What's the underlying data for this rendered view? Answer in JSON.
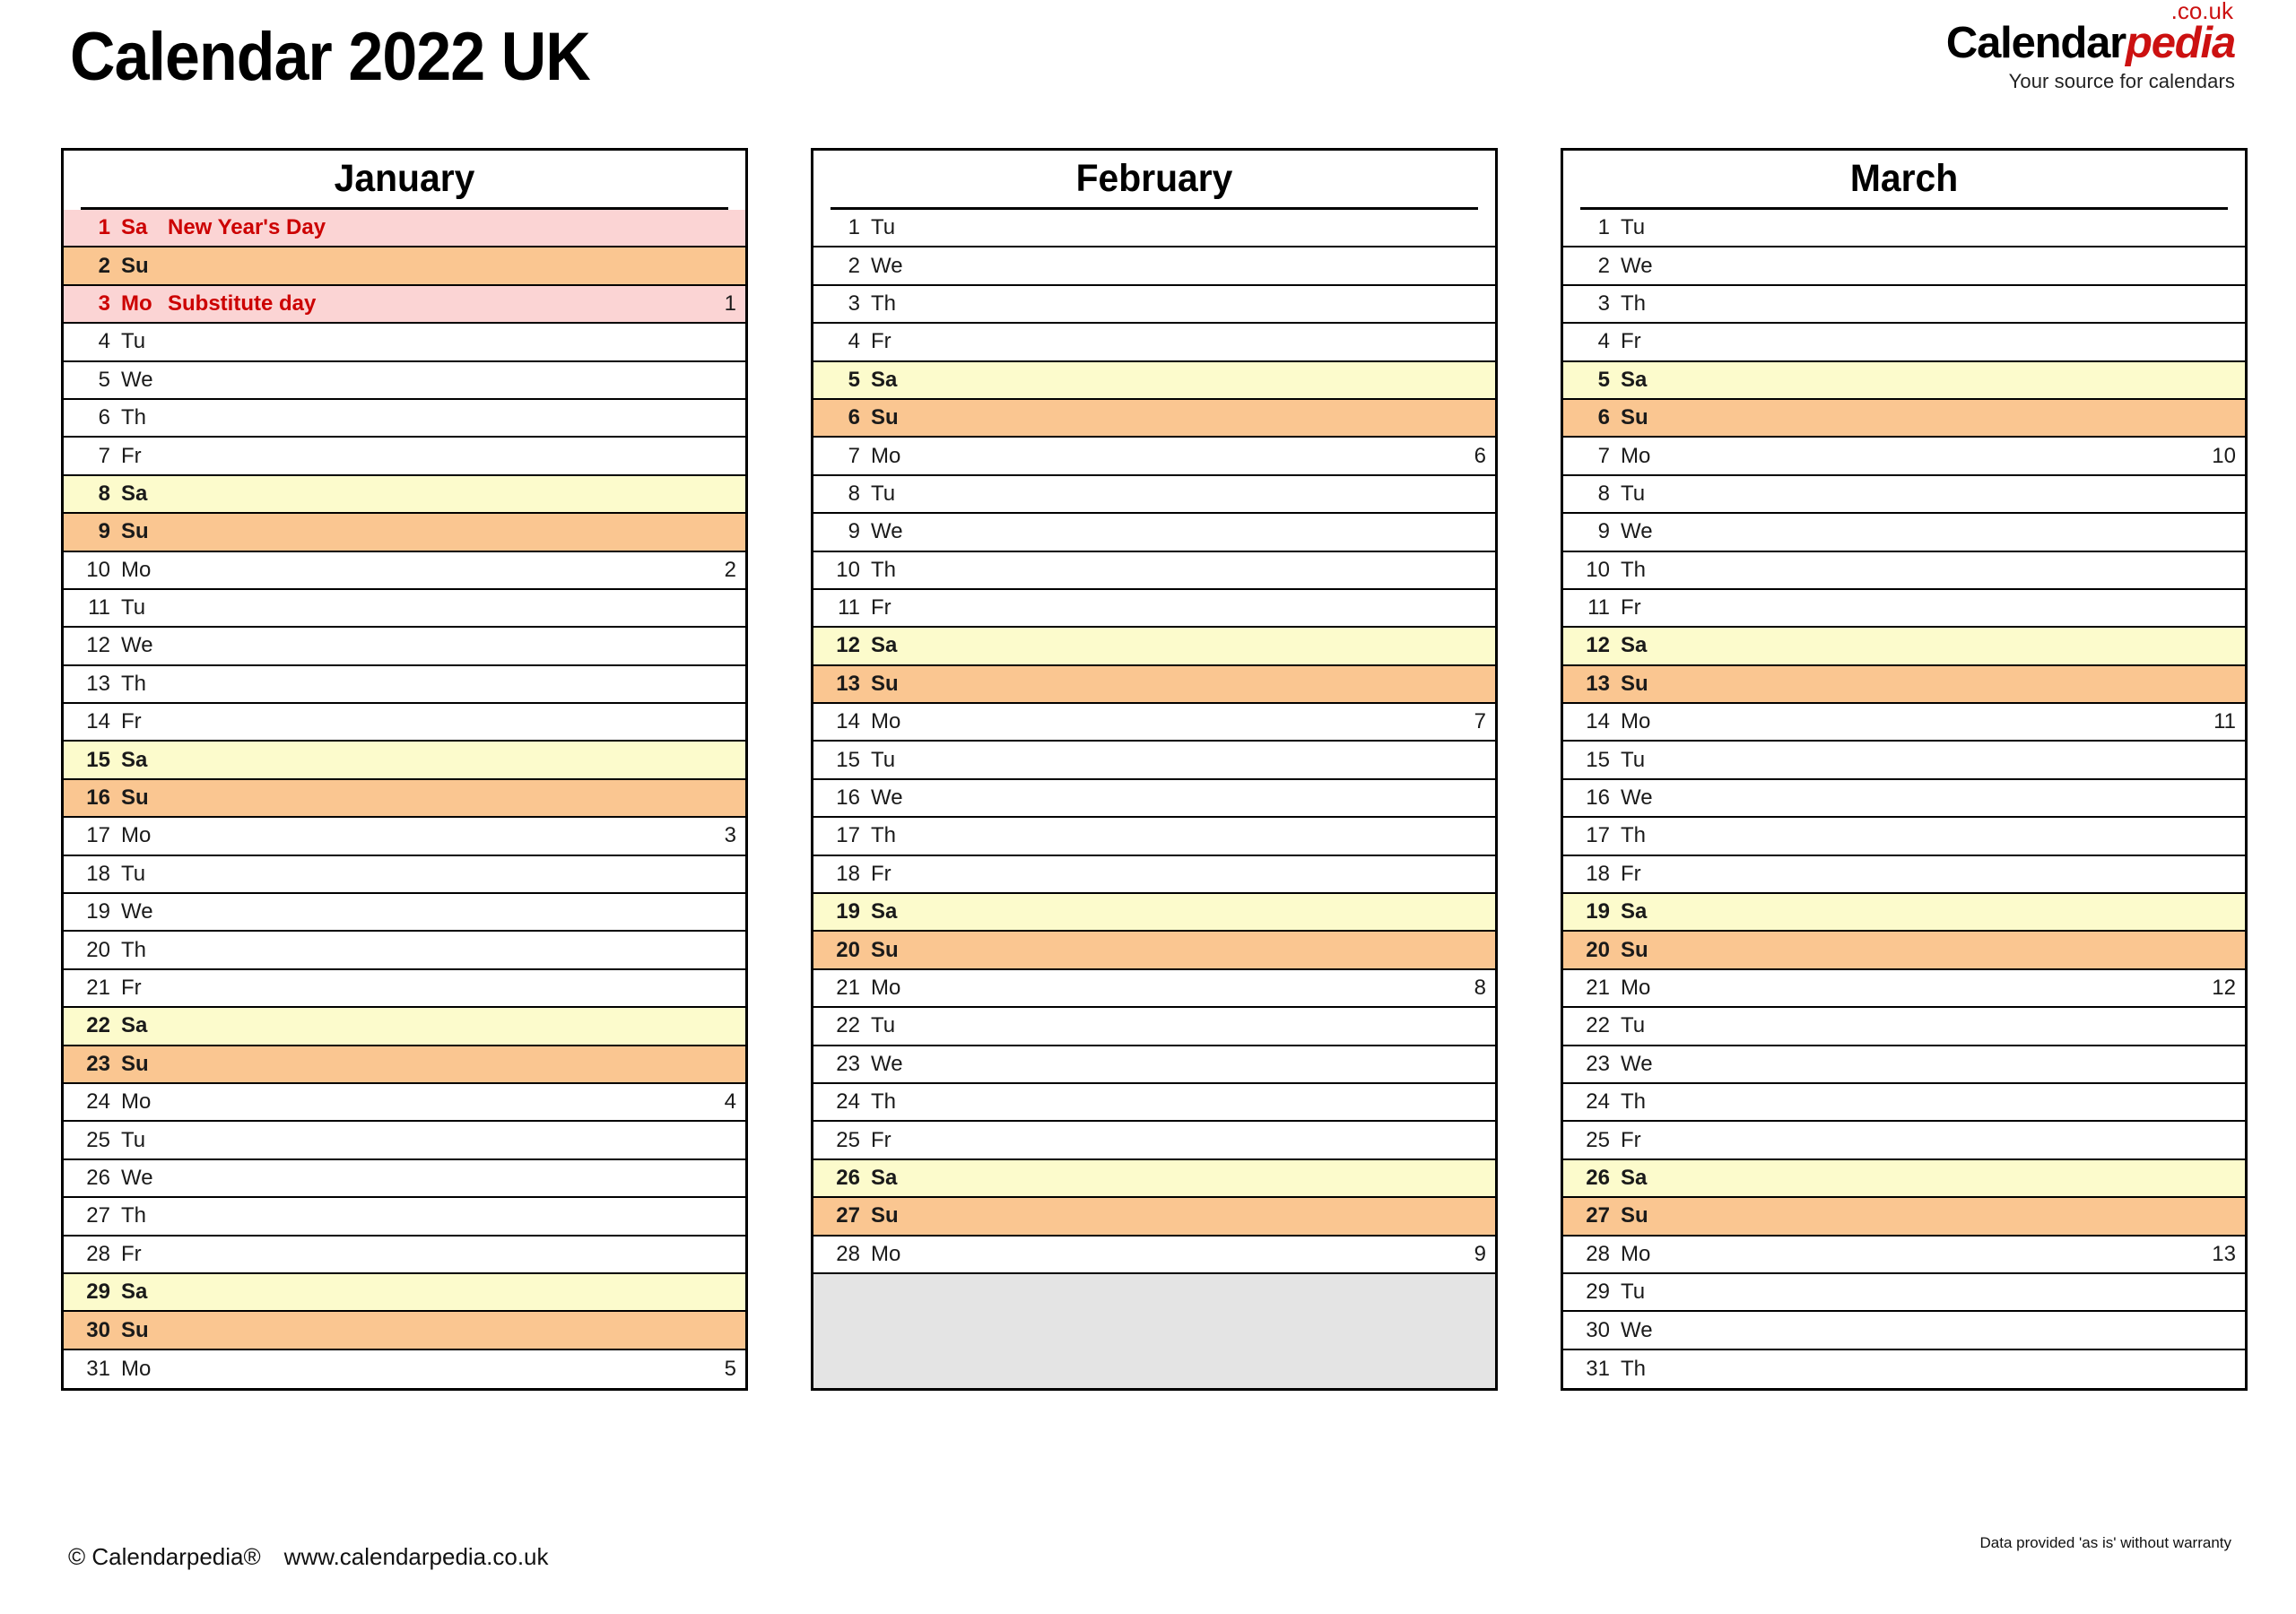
{
  "header": {
    "title": "Calendar 2022 UK",
    "brand": {
      "word1": "Calendar",
      "word2": "pedia",
      "tld": ".co.uk",
      "tagline": "Your source for calendars"
    }
  },
  "footer": {
    "copyright": "© Calendarpedia®",
    "website": "www.calendarpedia.co.uk",
    "disclaimer": "Data provided 'as is' without warranty"
  },
  "colors": {
    "saturday": "#fcfbcc",
    "sunday": "#fac691",
    "holiday": "#fbd4d4",
    "holiday_text": "#cc0000",
    "filler": "#e4e4e4",
    "brand_red": "#cc1111",
    "border": "#000000"
  },
  "months": [
    {
      "name": "January",
      "days": [
        {
          "num": "1",
          "wd": "Sa",
          "note": "New Year's Day",
          "week": "",
          "type": "holiday"
        },
        {
          "num": "2",
          "wd": "Su",
          "note": "",
          "week": "",
          "type": "sun"
        },
        {
          "num": "3",
          "wd": "Mo",
          "note": "Substitute day",
          "week": "1",
          "type": "holiday"
        },
        {
          "num": "4",
          "wd": "Tu",
          "note": "",
          "week": "",
          "type": "weekday"
        },
        {
          "num": "5",
          "wd": "We",
          "note": "",
          "week": "",
          "type": "weekday"
        },
        {
          "num": "6",
          "wd": "Th",
          "note": "",
          "week": "",
          "type": "weekday"
        },
        {
          "num": "7",
          "wd": "Fr",
          "note": "",
          "week": "",
          "type": "weekday"
        },
        {
          "num": "8",
          "wd": "Sa",
          "note": "",
          "week": "",
          "type": "sat"
        },
        {
          "num": "9",
          "wd": "Su",
          "note": "",
          "week": "",
          "type": "sun"
        },
        {
          "num": "10",
          "wd": "Mo",
          "note": "",
          "week": "2",
          "type": "weekday"
        },
        {
          "num": "11",
          "wd": "Tu",
          "note": "",
          "week": "",
          "type": "weekday"
        },
        {
          "num": "12",
          "wd": "We",
          "note": "",
          "week": "",
          "type": "weekday"
        },
        {
          "num": "13",
          "wd": "Th",
          "note": "",
          "week": "",
          "type": "weekday"
        },
        {
          "num": "14",
          "wd": "Fr",
          "note": "",
          "week": "",
          "type": "weekday"
        },
        {
          "num": "15",
          "wd": "Sa",
          "note": "",
          "week": "",
          "type": "sat"
        },
        {
          "num": "16",
          "wd": "Su",
          "note": "",
          "week": "",
          "type": "sun"
        },
        {
          "num": "17",
          "wd": "Mo",
          "note": "",
          "week": "3",
          "type": "weekday"
        },
        {
          "num": "18",
          "wd": "Tu",
          "note": "",
          "week": "",
          "type": "weekday"
        },
        {
          "num": "19",
          "wd": "We",
          "note": "",
          "week": "",
          "type": "weekday"
        },
        {
          "num": "20",
          "wd": "Th",
          "note": "",
          "week": "",
          "type": "weekday"
        },
        {
          "num": "21",
          "wd": "Fr",
          "note": "",
          "week": "",
          "type": "weekday"
        },
        {
          "num": "22",
          "wd": "Sa",
          "note": "",
          "week": "",
          "type": "sat"
        },
        {
          "num": "23",
          "wd": "Su",
          "note": "",
          "week": "",
          "type": "sun"
        },
        {
          "num": "24",
          "wd": "Mo",
          "note": "",
          "week": "4",
          "type": "weekday"
        },
        {
          "num": "25",
          "wd": "Tu",
          "note": "",
          "week": "",
          "type": "weekday"
        },
        {
          "num": "26",
          "wd": "We",
          "note": "",
          "week": "",
          "type": "weekday"
        },
        {
          "num": "27",
          "wd": "Th",
          "note": "",
          "week": "",
          "type": "weekday"
        },
        {
          "num": "28",
          "wd": "Fr",
          "note": "",
          "week": "",
          "type": "weekday"
        },
        {
          "num": "29",
          "wd": "Sa",
          "note": "",
          "week": "",
          "type": "sat"
        },
        {
          "num": "30",
          "wd": "Su",
          "note": "",
          "week": "",
          "type": "sun"
        },
        {
          "num": "31",
          "wd": "Mo",
          "note": "",
          "week": "5",
          "type": "weekday"
        }
      ],
      "filler_rows": 0
    },
    {
      "name": "February",
      "days": [
        {
          "num": "1",
          "wd": "Tu",
          "note": "",
          "week": "",
          "type": "weekday"
        },
        {
          "num": "2",
          "wd": "We",
          "note": "",
          "week": "",
          "type": "weekday"
        },
        {
          "num": "3",
          "wd": "Th",
          "note": "",
          "week": "",
          "type": "weekday"
        },
        {
          "num": "4",
          "wd": "Fr",
          "note": "",
          "week": "",
          "type": "weekday"
        },
        {
          "num": "5",
          "wd": "Sa",
          "note": "",
          "week": "",
          "type": "sat"
        },
        {
          "num": "6",
          "wd": "Su",
          "note": "",
          "week": "",
          "type": "sun"
        },
        {
          "num": "7",
          "wd": "Mo",
          "note": "",
          "week": "6",
          "type": "weekday"
        },
        {
          "num": "8",
          "wd": "Tu",
          "note": "",
          "week": "",
          "type": "weekday"
        },
        {
          "num": "9",
          "wd": "We",
          "note": "",
          "week": "",
          "type": "weekday"
        },
        {
          "num": "10",
          "wd": "Th",
          "note": "",
          "week": "",
          "type": "weekday"
        },
        {
          "num": "11",
          "wd": "Fr",
          "note": "",
          "week": "",
          "type": "weekday"
        },
        {
          "num": "12",
          "wd": "Sa",
          "note": "",
          "week": "",
          "type": "sat"
        },
        {
          "num": "13",
          "wd": "Su",
          "note": "",
          "week": "",
          "type": "sun"
        },
        {
          "num": "14",
          "wd": "Mo",
          "note": "",
          "week": "7",
          "type": "weekday"
        },
        {
          "num": "15",
          "wd": "Tu",
          "note": "",
          "week": "",
          "type": "weekday"
        },
        {
          "num": "16",
          "wd": "We",
          "note": "",
          "week": "",
          "type": "weekday"
        },
        {
          "num": "17",
          "wd": "Th",
          "note": "",
          "week": "",
          "type": "weekday"
        },
        {
          "num": "18",
          "wd": "Fr",
          "note": "",
          "week": "",
          "type": "weekday"
        },
        {
          "num": "19",
          "wd": "Sa",
          "note": "",
          "week": "",
          "type": "sat"
        },
        {
          "num": "20",
          "wd": "Su",
          "note": "",
          "week": "",
          "type": "sun"
        },
        {
          "num": "21",
          "wd": "Mo",
          "note": "",
          "week": "8",
          "type": "weekday"
        },
        {
          "num": "22",
          "wd": "Tu",
          "note": "",
          "week": "",
          "type": "weekday"
        },
        {
          "num": "23",
          "wd": "We",
          "note": "",
          "week": "",
          "type": "weekday"
        },
        {
          "num": "24",
          "wd": "Th",
          "note": "",
          "week": "",
          "type": "weekday"
        },
        {
          "num": "25",
          "wd": "Fr",
          "note": "",
          "week": "",
          "type": "weekday"
        },
        {
          "num": "26",
          "wd": "Sa",
          "note": "",
          "week": "",
          "type": "sat"
        },
        {
          "num": "27",
          "wd": "Su",
          "note": "",
          "week": "",
          "type": "sun"
        },
        {
          "num": "28",
          "wd": "Mo",
          "note": "",
          "week": "9",
          "type": "weekday"
        }
      ],
      "filler_rows": 3
    },
    {
      "name": "March",
      "days": [
        {
          "num": "1",
          "wd": "Tu",
          "note": "",
          "week": "",
          "type": "weekday"
        },
        {
          "num": "2",
          "wd": "We",
          "note": "",
          "week": "",
          "type": "weekday"
        },
        {
          "num": "3",
          "wd": "Th",
          "note": "",
          "week": "",
          "type": "weekday"
        },
        {
          "num": "4",
          "wd": "Fr",
          "note": "",
          "week": "",
          "type": "weekday"
        },
        {
          "num": "5",
          "wd": "Sa",
          "note": "",
          "week": "",
          "type": "sat"
        },
        {
          "num": "6",
          "wd": "Su",
          "note": "",
          "week": "",
          "type": "sun"
        },
        {
          "num": "7",
          "wd": "Mo",
          "note": "",
          "week": "10",
          "type": "weekday"
        },
        {
          "num": "8",
          "wd": "Tu",
          "note": "",
          "week": "",
          "type": "weekday"
        },
        {
          "num": "9",
          "wd": "We",
          "note": "",
          "week": "",
          "type": "weekday"
        },
        {
          "num": "10",
          "wd": "Th",
          "note": "",
          "week": "",
          "type": "weekday"
        },
        {
          "num": "11",
          "wd": "Fr",
          "note": "",
          "week": "",
          "type": "weekday"
        },
        {
          "num": "12",
          "wd": "Sa",
          "note": "",
          "week": "",
          "type": "sat"
        },
        {
          "num": "13",
          "wd": "Su",
          "note": "",
          "week": "",
          "type": "sun"
        },
        {
          "num": "14",
          "wd": "Mo",
          "note": "",
          "week": "11",
          "type": "weekday"
        },
        {
          "num": "15",
          "wd": "Tu",
          "note": "",
          "week": "",
          "type": "weekday"
        },
        {
          "num": "16",
          "wd": "We",
          "note": "",
          "week": "",
          "type": "weekday"
        },
        {
          "num": "17",
          "wd": "Th",
          "note": "",
          "week": "",
          "type": "weekday"
        },
        {
          "num": "18",
          "wd": "Fr",
          "note": "",
          "week": "",
          "type": "weekday"
        },
        {
          "num": "19",
          "wd": "Sa",
          "note": "",
          "week": "",
          "type": "sat"
        },
        {
          "num": "20",
          "wd": "Su",
          "note": "",
          "week": "",
          "type": "sun"
        },
        {
          "num": "21",
          "wd": "Mo",
          "note": "",
          "week": "12",
          "type": "weekday"
        },
        {
          "num": "22",
          "wd": "Tu",
          "note": "",
          "week": "",
          "type": "weekday"
        },
        {
          "num": "23",
          "wd": "We",
          "note": "",
          "week": "",
          "type": "weekday"
        },
        {
          "num": "24",
          "wd": "Th",
          "note": "",
          "week": "",
          "type": "weekday"
        },
        {
          "num": "25",
          "wd": "Fr",
          "note": "",
          "week": "",
          "type": "weekday"
        },
        {
          "num": "26",
          "wd": "Sa",
          "note": "",
          "week": "",
          "type": "sat"
        },
        {
          "num": "27",
          "wd": "Su",
          "note": "",
          "week": "",
          "type": "sun"
        },
        {
          "num": "28",
          "wd": "Mo",
          "note": "",
          "week": "13",
          "type": "weekday"
        },
        {
          "num": "29",
          "wd": "Tu",
          "note": "",
          "week": "",
          "type": "weekday"
        },
        {
          "num": "30",
          "wd": "We",
          "note": "",
          "week": "",
          "type": "weekday"
        },
        {
          "num": "31",
          "wd": "Th",
          "note": "",
          "week": "",
          "type": "weekday"
        }
      ],
      "filler_rows": 0
    }
  ]
}
